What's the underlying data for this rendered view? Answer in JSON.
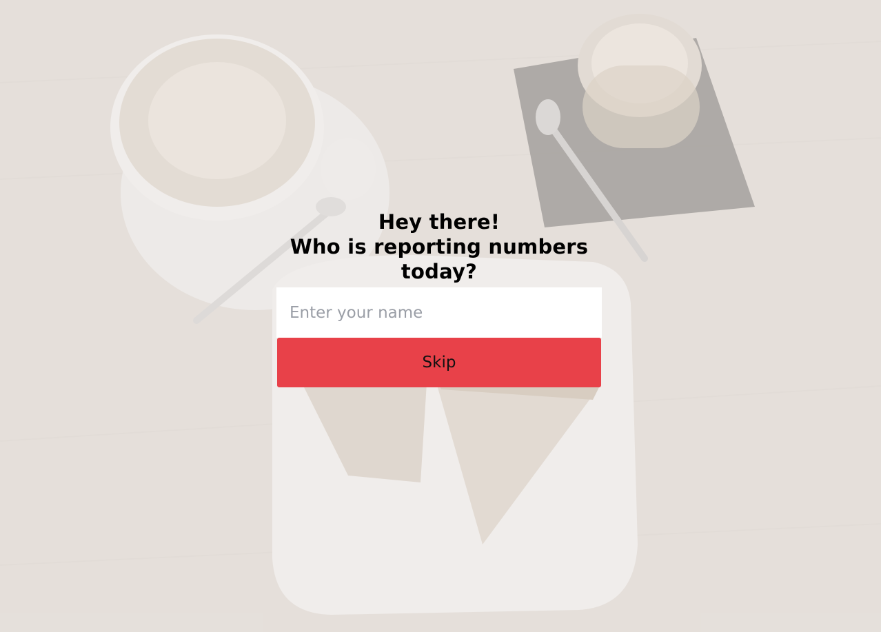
{
  "prompt": {
    "heading_line1": "Hey there!",
    "heading_line2": "Who is reporting numbers today?"
  },
  "name_field": {
    "placeholder": "Enter your name",
    "value": ""
  },
  "skip_button": {
    "label": "Skip"
  },
  "colors": {
    "accent": "#e84149",
    "background": "#e6e2dc",
    "input_background": "#ffffff",
    "heading_text": "#000000"
  }
}
